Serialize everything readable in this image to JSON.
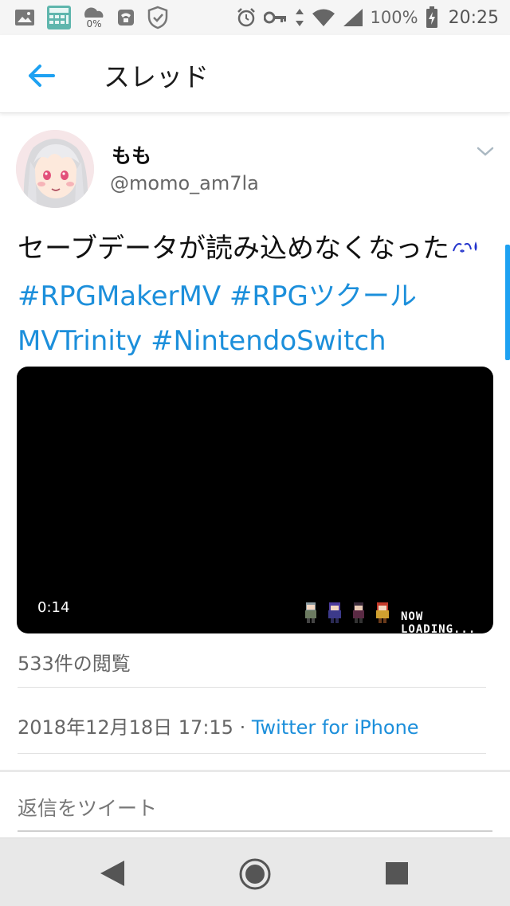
{
  "status_bar": {
    "battery_percent": "100%",
    "time": "20:25",
    "data_saver_text": "0%"
  },
  "app_bar": {
    "title": "スレッド"
  },
  "tweet": {
    "display_name": "もも",
    "handle": "@momo_am7la",
    "text_plain": "セーブデータが読み込めなくなった",
    "hashtags": [
      "#RPGMakerMV",
      "#RPGツクールMVTrinity",
      "#NintendoSwitch"
    ],
    "video": {
      "duration": "0:14",
      "overlay_text": "NOW LOADING..."
    },
    "views": "533件の閲覧",
    "timestamp": "2018年12月18日 17:15",
    "separator": " · ",
    "source": "Twitter for iPhone"
  },
  "reply": {
    "placeholder": "返信をツイート"
  },
  "colors": {
    "link": "#1c8fdb",
    "accent": "#1da1f2"
  }
}
